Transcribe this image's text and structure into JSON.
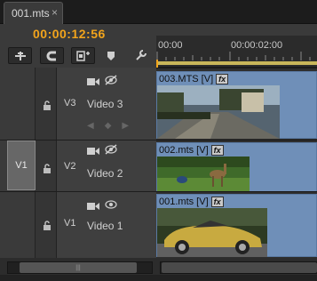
{
  "tab": {
    "label": "001.mts",
    "close": "×"
  },
  "timecode": "00:00:12:56",
  "toolbar": {
    "tools": [
      {
        "name": "snap-tool",
        "icon": "snap-icon"
      },
      {
        "name": "linked-selection-tool",
        "icon": "magnet-icon"
      },
      {
        "name": "add-marker-tool",
        "icon": "marker-icon"
      },
      {
        "name": "timeline-marker-tool",
        "icon": "flag-icon"
      },
      {
        "name": "settings-tool",
        "icon": "wrench-icon"
      }
    ]
  },
  "ruler": {
    "start": "00:00",
    "mid": "00:00:02:00"
  },
  "source_patch": {
    "label": "V1"
  },
  "tracks": [
    {
      "id": "V3",
      "name": "Video 3",
      "clip": "003.MTS [V]",
      "fx": "fx"
    },
    {
      "id": "V2",
      "name": "Video 2",
      "clip": "002.mts [V]",
      "fx": "fx"
    },
    {
      "id": "V1",
      "name": "Video 1",
      "clip": "001.mts [V]",
      "fx": "fx"
    }
  ],
  "scrollbar": {
    "grip": "|||"
  },
  "colors": {
    "timecode": "#f2a41c",
    "clip": "#6f8fb8",
    "work_area": "#c9b65a"
  }
}
